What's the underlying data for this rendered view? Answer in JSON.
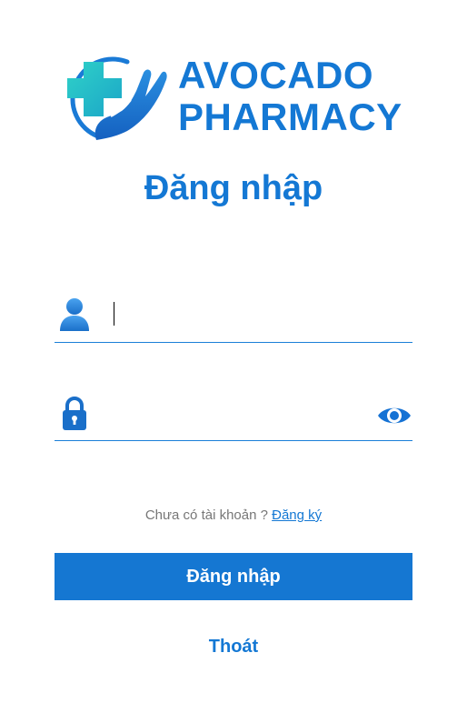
{
  "brand": {
    "line1": "AVOCADO",
    "line2": "PHARMACY",
    "color": "#1478d4",
    "logo_icon": "medical-cross-hand-icon"
  },
  "login_form": {
    "title": "Đăng nhập",
    "username": {
      "icon": "user-icon",
      "value": "",
      "placeholder": ""
    },
    "password": {
      "icon": "lock-icon",
      "value": "",
      "placeholder": "",
      "toggle_icon": "eye-icon"
    },
    "signup_prompt": "Chưa có tài khoản ?",
    "signup_link": "Đăng ký",
    "submit_label": "Đăng nhập",
    "exit_label": "Thoát"
  },
  "colors": {
    "primary": "#1577d2",
    "accent_teal": "#2cc6c6",
    "muted_text": "#777777"
  }
}
